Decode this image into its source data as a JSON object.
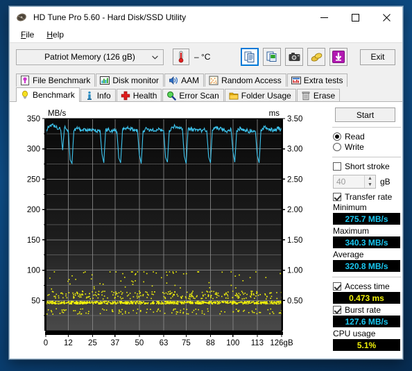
{
  "window": {
    "title": "HD Tune Pro 5.60 - Hard Disk/SSD Utility",
    "app_icon": "harddisk-icon",
    "minimize": "─",
    "maximize": "□",
    "close": "✕"
  },
  "menu": {
    "items": [
      {
        "label": "File",
        "accel": "F"
      },
      {
        "label": "Help",
        "accel": "H"
      }
    ]
  },
  "toolbar": {
    "drive": "Patriot Memory (126 gB)",
    "drive_chevron": "chevron-down-icon",
    "temperature": "– °C",
    "thermometer_icon": "thermometer-icon",
    "buttons": [
      {
        "name": "copy-text-icon",
        "selected": true
      },
      {
        "name": "copy-image-icon",
        "selected": false
      },
      {
        "name": "screenshot-camera-icon",
        "selected": false
      },
      {
        "name": "coins-icon",
        "selected": false
      },
      {
        "name": "download-arrow-icon",
        "selected": false
      }
    ],
    "exit_label": "Exit"
  },
  "tabs": {
    "row1": [
      {
        "label": "File Benchmark",
        "icon": "file-benchmark-icon",
        "active": false
      },
      {
        "label": "Disk monitor",
        "icon": "disk-monitor-icon",
        "active": false
      },
      {
        "label": "AAM",
        "icon": "speaker-icon",
        "active": false
      },
      {
        "label": "Random Access",
        "icon": "random-access-icon",
        "active": false
      },
      {
        "label": "Extra tests",
        "icon": "extra-tests-icon",
        "active": false
      }
    ],
    "row2": [
      {
        "label": "Benchmark",
        "icon": "lightbulb-icon",
        "active": true
      },
      {
        "label": "Info",
        "icon": "info-icon",
        "active": false
      },
      {
        "label": "Health",
        "icon": "health-cross-icon",
        "active": false
      },
      {
        "label": "Error Scan",
        "icon": "magnifier-icon",
        "active": false
      },
      {
        "label": "Folder Usage",
        "icon": "folder-icon",
        "active": false
      },
      {
        "label": "Erase",
        "icon": "trash-icon",
        "active": false
      }
    ]
  },
  "panel": {
    "start_label": "Start",
    "read_label": "Read",
    "write_label": "Write",
    "read_selected": true,
    "short_stroke_label": "Short stroke",
    "short_stroke_checked": false,
    "short_stroke_value": "40",
    "short_stroke_unit": "gB",
    "transfer_rate_label": "Transfer rate",
    "transfer_rate_checked": true,
    "minimum_label": "Minimum",
    "minimum_value": "275.7 MB/s",
    "maximum_label": "Maximum",
    "maximum_value": "340.3 MB/s",
    "average_label": "Average",
    "average_value": "320.8 MB/s",
    "access_time_label": "Access time",
    "access_time_checked": true,
    "access_time_value": "0.473 ms",
    "burst_rate_label": "Burst rate",
    "burst_rate_checked": true,
    "burst_rate_value": "127.6 MB/s",
    "cpu_usage_label": "CPU usage",
    "cpu_usage_value": "5.1%"
  },
  "colors": {
    "transfer_line": "#3ec6f0",
    "access_dots": "#f2f20a",
    "lcd_bg": "#000000",
    "accent": "#0078d7",
    "plot_grid": "#8a8a8a"
  },
  "chart_data": {
    "type": "line",
    "title": "",
    "ylabel": "MB/s",
    "y2label": "ms",
    "xlabel": "",
    "ylim": [
      0,
      350
    ],
    "y2lim": [
      0,
      3.5
    ],
    "xlim": [
      0,
      126
    ],
    "grid": true,
    "yticks": [
      50,
      100,
      150,
      200,
      250,
      300,
      350
    ],
    "y2ticks": [
      0.5,
      1.0,
      1.5,
      2.0,
      2.5,
      3.0,
      3.5
    ],
    "xticks": [
      0,
      12,
      25,
      37,
      50,
      63,
      75,
      88,
      100,
      113,
      126
    ],
    "xtick_labels": [
      "0",
      "12",
      "25",
      "37",
      "50",
      "63",
      "75",
      "88",
      "100",
      "113",
      "126gB"
    ],
    "series": [
      {
        "name": "Transfer rate",
        "axis": "left",
        "color": "#3ec6f0",
        "units": "MB/s",
        "x": [
          0,
          1,
          2,
          3,
          4,
          5,
          6,
          7,
          8,
          9,
          10,
          11,
          12,
          13,
          14,
          15,
          16,
          17,
          18,
          19,
          20,
          21,
          22,
          23,
          24,
          25,
          26,
          27,
          28,
          29,
          30,
          31,
          32,
          33,
          34,
          35,
          36,
          37,
          38,
          39,
          40,
          41,
          42,
          43,
          44,
          45,
          46,
          47,
          48,
          49,
          50,
          51,
          52,
          53,
          54,
          55,
          56,
          57,
          58,
          59,
          60,
          61,
          62,
          63,
          64,
          65,
          66,
          67,
          68,
          69,
          70,
          71,
          72,
          73,
          74,
          75,
          76,
          77,
          78,
          79,
          80,
          81,
          82,
          83,
          84,
          85,
          86,
          87,
          88,
          89,
          90,
          91,
          92,
          93,
          94,
          95,
          96,
          97,
          98,
          99,
          100,
          101,
          102,
          103,
          104,
          105,
          106,
          107,
          108,
          109,
          110,
          111,
          112,
          113,
          114,
          115,
          116,
          117,
          118,
          119,
          120,
          121,
          122,
          123,
          124,
          125,
          126
        ],
        "y": [
          330,
          334,
          338,
          340,
          339,
          336,
          334,
          333,
          331,
          298,
          335,
          332,
          330,
          282,
          276,
          330,
          334,
          333,
          332,
          330,
          329,
          333,
          331,
          330,
          332,
          331,
          330,
          329,
          330,
          331,
          292,
          277,
          331,
          333,
          330,
          329,
          332,
          330,
          329,
          285,
          277,
          331,
          333,
          335,
          334,
          332,
          333,
          332,
          331,
          330,
          290,
          276,
          330,
          332,
          334,
          333,
          331,
          332,
          330,
          329,
          331,
          333,
          332,
          330,
          286,
          278,
          331,
          334,
          336,
          338,
          337,
          335,
          334,
          333,
          288,
          276,
          332,
          334,
          333,
          331,
          330,
          332,
          331,
          330,
          332,
          331,
          330,
          287,
          277,
          331,
          333,
          335,
          334,
          333,
          332,
          331,
          330,
          329,
          331,
          333,
          296,
          278,
          330,
          332,
          334,
          333,
          332,
          331,
          330,
          329,
          331,
          330,
          329,
          289,
          277,
          332,
          334,
          336,
          335,
          333,
          332,
          331,
          330,
          332,
          334,
          333,
          331
        ]
      },
      {
        "name": "Access time",
        "axis": "right",
        "color": "#f2f20a",
        "units": "ms",
        "mean": 0.473,
        "spread": [
          0.3,
          0.95
        ],
        "description": "Dense scatter of access-time samples clustered around 0.45-0.50 ms with occasional outliers up to ~0.95 ms"
      }
    ]
  }
}
